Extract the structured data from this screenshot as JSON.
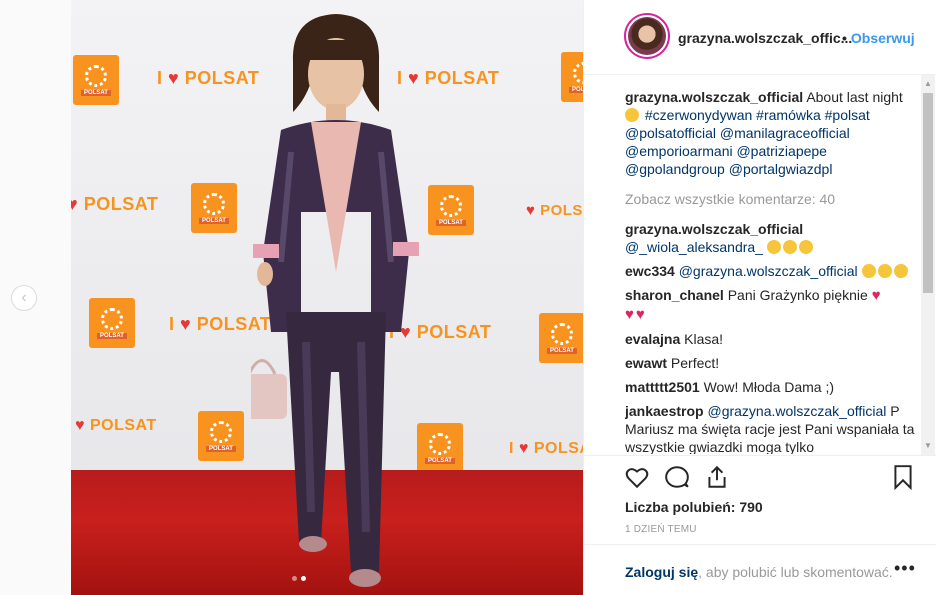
{
  "post": {
    "username": "grazyna.wolszczak_offic...",
    "follow_bullet": "•",
    "follow_label": "Obserwuj"
  },
  "photo": {
    "logo_text": "POLSAT",
    "ilove_text": "POLSAT",
    "heart": "♥",
    "carousel_dots": 2,
    "active_dot": 1
  },
  "caption": {
    "user": "grazyna.wolszczak_official",
    "text": "About last night",
    "tags": "#czerwonydywan #ramówka #polsat",
    "mentions_1": "@polsatofficial @manilagraceofficial",
    "mentions_2": "@emporioarmani @patriziapepe",
    "mentions_3": "@gpolandgroup @portalgwiazdpl"
  },
  "view_all": "Zobacz wszystkie komentarze: 40",
  "comments": [
    {
      "user": "grazyna.wolszczak_official",
      "text": "@_wiola_aleksandra_"
    },
    {
      "user": "ewc334",
      "text": "@grazyna.wolszczak_official"
    },
    {
      "user": "sharon_chanel",
      "text": "Pani Grażynko pięknie"
    },
    {
      "user": "evalajna",
      "text": "Klasa!"
    },
    {
      "user": "ewawt",
      "text": "Perfect!"
    },
    {
      "user": "mattttt2501",
      "text": "Wow! Młoda Dama ;)"
    },
    {
      "user": "jankaestrop",
      "text": "@grazyna.wolszczak_official",
      "text2": "P Mariusz ma święta racje jest Pani wspaniała ta wszystkie gwiazdki moga tylko"
    }
  ],
  "likes_label": "Liczba polubień:",
  "likes_count": "790",
  "timestamp": "1 DZIEŃ TEMU",
  "login": {
    "link": "Zaloguj się",
    "text": ", aby polubić lub skomentować.",
    "more": "•••"
  },
  "icons": {
    "like": "heart-outline-icon",
    "comment": "comment-bubble-icon",
    "share": "share-icon",
    "save": "bookmark-icon",
    "prev": "chevron-left-icon"
  },
  "colors": {
    "link": "#003569",
    "follow": "#3897f0",
    "muted": "#999999",
    "heart": "#e0245e"
  }
}
